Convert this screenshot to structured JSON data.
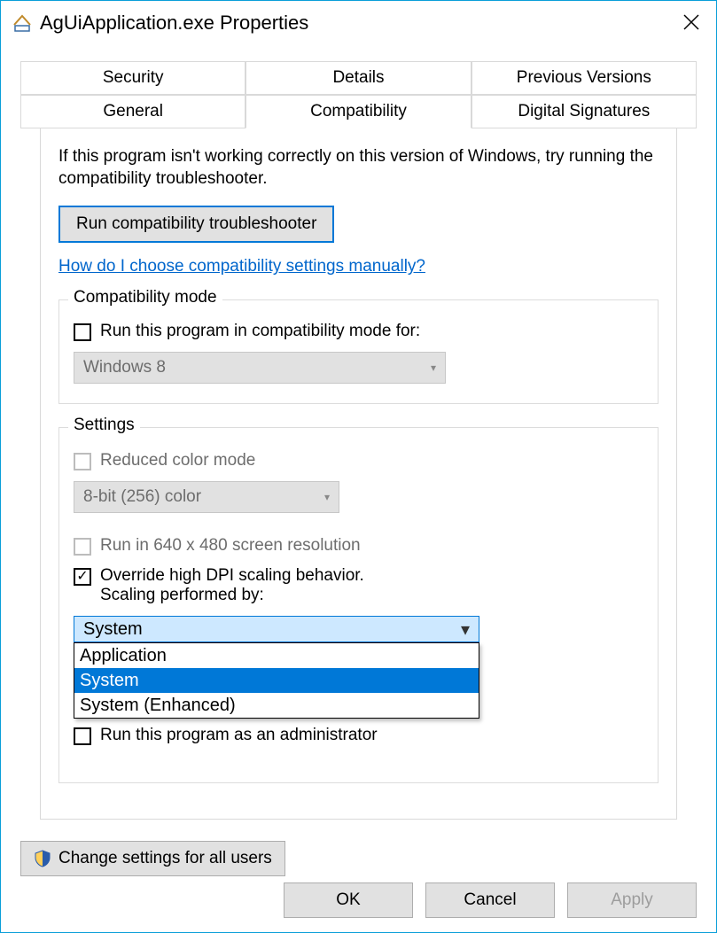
{
  "window": {
    "title": "AgUiApplication.exe Properties"
  },
  "tabs": {
    "row1": [
      "Security",
      "Details",
      "Previous Versions"
    ],
    "row2": [
      "General",
      "Compatibility",
      "Digital Signatures"
    ],
    "active": "Compatibility"
  },
  "intro": "If this program isn't working correctly on this version of Windows, try running the compatibility troubleshooter.",
  "troubleshooter_button": "Run compatibility troubleshooter",
  "help_link": "How do I choose compatibility settings manually?",
  "compat_mode_group": {
    "label": "Compatibility mode",
    "checkbox_label": "Run this program in compatibility mode for:",
    "combo_value": "Windows 8"
  },
  "settings_group": {
    "label": "Settings",
    "reduced_color_label": "Reduced color mode",
    "color_combo": "8-bit (256) color",
    "resolution_label": "Run in 640 x 480 screen resolution",
    "dpi_label_line1": "Override high DPI scaling behavior.",
    "dpi_label_line2": "Scaling performed by:",
    "dpi_combo_selected": "System",
    "dpi_combo_options": [
      "Application",
      "System",
      "System (Enhanced)"
    ],
    "admin_label": "Run this program as an administrator"
  },
  "change_all_users": "Change settings for all users",
  "dialog_buttons": {
    "ok": "OK",
    "cancel": "Cancel",
    "apply": "Apply"
  }
}
